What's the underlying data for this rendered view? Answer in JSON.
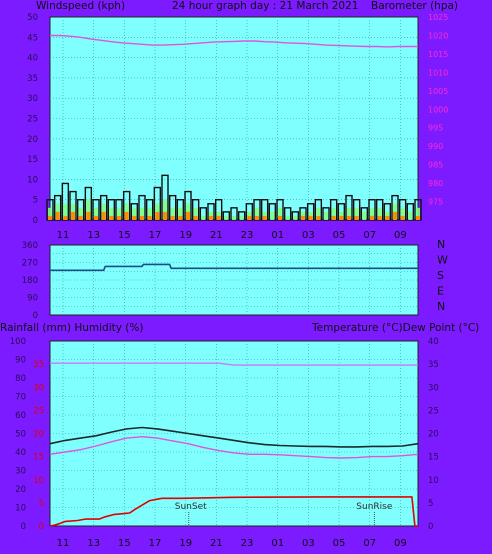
{
  "header": {
    "left": "Windspeed (kph)",
    "center": "24 hour graph day : 21 March 2021",
    "right": "Barometer (hpa)"
  },
  "bottom_header": {
    "left": "Rainfall (mm)  Humidity (%)",
    "right": "Temperature (°C)Dew Point (°C)"
  },
  "x_ticks": [
    "11",
    "13",
    "15",
    "17",
    "19",
    "21",
    "23",
    "01",
    "03",
    "05",
    "07",
    "09"
  ],
  "annotations": {
    "sunset": "SunSet",
    "sunrise": "SunRise"
  },
  "directions": [
    "N",
    "W",
    "S",
    "E",
    "N"
  ],
  "colors": {
    "plot_bg": "#80ffff",
    "grid": "#3a9e9e",
    "frame_bg": "#7c1bff",
    "gust": "#101010",
    "avg": "#7fff7f",
    "min": "#ff8c00",
    "barometer": "#dd55dd",
    "temperature": "#1a2a2a",
    "dewpoint": "#dd55dd",
    "humidity": "#cc77ff",
    "rainfall": "#e00000",
    "direction": "#1a4e8a"
  },
  "chart_data": [
    {
      "type": "line",
      "name": "wind-barometer",
      "ylabel": "Windspeed (kph)",
      "y2label": "Barometer (hpa)",
      "ylim": [
        0,
        50
      ],
      "y2lim": [
        970,
        1025
      ],
      "yticks": [
        "0",
        "5",
        "10",
        "15",
        "20",
        "25",
        "30",
        "35",
        "40",
        "45",
        "50"
      ],
      "y2ticks": [
        "975",
        "980",
        "985",
        "990",
        "995",
        "1000",
        "1005",
        "1010",
        "1015",
        "1020",
        "1025"
      ],
      "x_hours_from_start": [
        0,
        0.5,
        1,
        1.5,
        2,
        2.5,
        3,
        3.5,
        4,
        4.5,
        5,
        5.5,
        6,
        6.5,
        7,
        7.5,
        8,
        8.5,
        9,
        9.5,
        10,
        10.5,
        11,
        11.5,
        12,
        12.5,
        13,
        13.5,
        14,
        14.5,
        15,
        15.5,
        16,
        16.5,
        17,
        17.5,
        18,
        18.5,
        19,
        19.5,
        20,
        20.5,
        21,
        21.5,
        22,
        22.5,
        23,
        23.5,
        24
      ],
      "series": [
        {
          "role": "gust",
          "values": [
            5,
            6,
            9,
            7,
            5,
            8,
            5,
            6,
            5,
            5,
            7,
            4,
            6,
            5,
            8,
            11,
            6,
            5,
            7,
            5,
            3,
            4,
            5,
            2,
            3,
            2,
            4,
            5,
            5,
            4,
            5,
            3,
            2,
            3,
            4,
            5,
            3,
            5,
            4,
            6,
            5,
            3,
            5,
            5,
            4,
            6,
            5,
            4,
            5
          ]
        },
        {
          "role": "average",
          "values": [
            3,
            4,
            4,
            4,
            3,
            5,
            3,
            4,
            3,
            3,
            4,
            3,
            3,
            3,
            4,
            5,
            3,
            3,
            4,
            3,
            1,
            2,
            2,
            1,
            1,
            1,
            2,
            3,
            2,
            2,
            3,
            1,
            1,
            2,
            2,
            3,
            2,
            3,
            2,
            3,
            3,
            2,
            3,
            3,
            2,
            4,
            3,
            2,
            3
          ]
        },
        {
          "role": "minimum",
          "values": [
            1,
            2,
            1,
            2,
            1,
            2,
            1,
            2,
            1,
            1,
            2,
            1,
            1,
            1,
            2,
            2,
            1,
            1,
            2,
            1,
            0,
            1,
            1,
            0,
            0,
            0,
            1,
            1,
            1,
            0,
            1,
            0,
            0,
            1,
            1,
            1,
            0,
            1,
            1,
            1,
            1,
            0,
            1,
            1,
            1,
            2,
            1,
            0,
            1
          ]
        },
        {
          "role": "barometer",
          "values": [
            1020,
            1020,
            1019.8,
            1019.5,
            1019,
            1018.7,
            1018.3,
            1018,
            1017.8,
            1017.6,
            1017.4,
            1017.4,
            1017.5,
            1017.6,
            1017.8,
            1018,
            1018.2,
            1018.3,
            1018.4,
            1018.5,
            1018.5,
            1018.3,
            1018.2,
            1018,
            1017.9,
            1017.8,
            1017.6,
            1017.4,
            1017.3,
            1017.2,
            1017.1,
            1017,
            1017,
            1016.9,
            1017,
            1017,
            1017
          ]
        }
      ]
    },
    {
      "type": "line",
      "name": "wind-direction",
      "ylim": [
        0,
        360
      ],
      "yticks": [
        "0",
        "45",
        "90",
        "135",
        "180",
        "225",
        "270",
        "315",
        "360"
      ],
      "y_labels_right": [
        "N",
        "W",
        "S",
        "E",
        "N"
      ],
      "x_hours_from_start": [
        0,
        3.5,
        3.6,
        6,
        6.1,
        7.8,
        7.9,
        24
      ],
      "values": [
        230,
        230,
        250,
        250,
        260,
        260,
        240,
        240
      ]
    },
    {
      "type": "line",
      "name": "temp-humidity-rain",
      "ylabel": "Rainfall (mm)  Humidity (%)",
      "y2label": "Temperature (°C)Dew Point (°C)",
      "ylim": [
        0,
        100
      ],
      "y2lim": [
        0,
        40
      ],
      "yticks": [
        "0",
        "10",
        "20",
        "30",
        "40",
        "50",
        "60",
        "70",
        "80",
        "90",
        "100"
      ],
      "rain_ticks": [
        "0",
        "5",
        "10",
        "15",
        "20",
        "25",
        "30",
        "35"
      ],
      "y2ticks": [
        "0",
        "5",
        "10",
        "15",
        "20",
        "25",
        "30",
        "35",
        "40"
      ],
      "x_hours_from_start": [
        0,
        1,
        2,
        3,
        4,
        5,
        6,
        7,
        8,
        9,
        10,
        11,
        12,
        13,
        14,
        15,
        16,
        17,
        18,
        19,
        20,
        21,
        22,
        23,
        24
      ],
      "series": [
        {
          "role": "temperature",
          "values": [
            17.8,
            18.5,
            19,
            19.5,
            20.3,
            21,
            21.3,
            21,
            20.5,
            20,
            19.5,
            19,
            18.5,
            18,
            17.6,
            17.4,
            17.3,
            17.2,
            17.2,
            17.1,
            17.1,
            17.2,
            17.2,
            17.3,
            17.8
          ]
        },
        {
          "role": "dewpoint",
          "values": [
            15.5,
            16,
            16.5,
            17.3,
            18.2,
            19,
            19.3,
            19,
            18.4,
            17.8,
            17,
            16.3,
            15.8,
            15.5,
            15.5,
            15.4,
            15.2,
            15,
            14.8,
            14.7,
            14.8,
            15,
            15,
            15.2,
            15.5
          ]
        },
        {
          "role": "humidity",
          "values": [
            88,
            88,
            88,
            88,
            88,
            88,
            88,
            88,
            88,
            88,
            88,
            88,
            87,
            87,
            87,
            87,
            87,
            87,
            87,
            87,
            87,
            87,
            87,
            87,
            87
          ]
        },
        {
          "role": "rainfall",
          "x_hours_from_start": [
            0,
            0.3,
            0.6,
            1,
            1.8,
            2.3,
            3.2,
            3.6,
            4.2,
            5.2,
            5.5,
            6,
            6.5,
            7.3,
            8.6,
            12,
            18,
            22,
            23.6,
            23.8,
            24
          ],
          "values": [
            0,
            0.2,
            0.5,
            1,
            1.2,
            1.5,
            1.5,
            2,
            2.5,
            2.8,
            3.5,
            4.5,
            5.5,
            6,
            6,
            6.2,
            6.3,
            6.3,
            6.3,
            0,
            0
          ]
        }
      ]
    }
  ]
}
